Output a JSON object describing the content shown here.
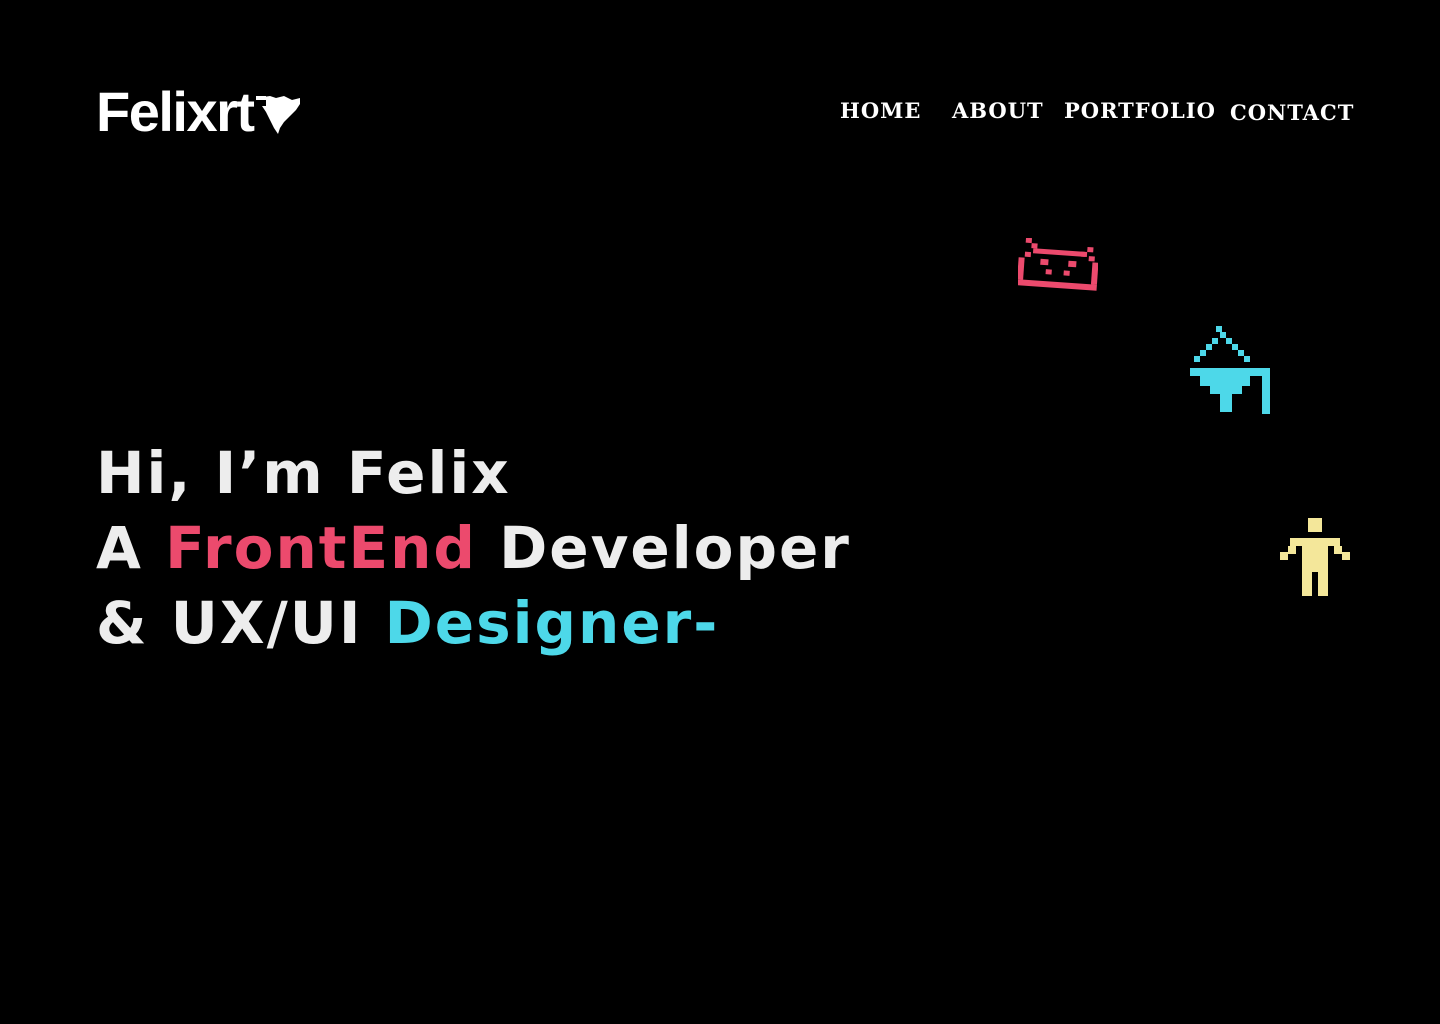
{
  "brand": {
    "name": "Felixrt"
  },
  "nav": {
    "items": [
      {
        "label": "HOME"
      },
      {
        "label": "ABOUT"
      },
      {
        "label": "PORTFOLIO"
      },
      {
        "label": "CONTACT"
      }
    ]
  },
  "hero": {
    "line1": "Hi, I’m Felix",
    "line2_prefix": "A ",
    "line2_highlight": "FrontEnd",
    "line2_suffix": " Developer",
    "line3_prefix": "& UX/UI ",
    "line3_highlight": "Designer-"
  },
  "colors": {
    "background": "#000000",
    "text": "#ededed",
    "accent_red": "#ec4a6d",
    "accent_cyan": "#4dd8e9",
    "accent_yellow": "#f4e79a"
  },
  "icons": {
    "logo_mark": "bird-icon",
    "invader_red": "pixel-invader-icon",
    "ship_cyan": "pixel-ship-icon",
    "figure_yellow": "pixel-person-icon"
  }
}
